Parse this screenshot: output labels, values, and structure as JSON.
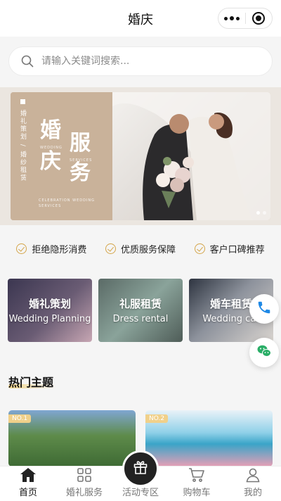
{
  "navbar": {
    "title": "婚庆"
  },
  "search": {
    "placeholder": "请输入关键词搜索..."
  },
  "banner": {
    "strip_text": "婚礼策划 / 婚纱租赁",
    "big": [
      "婚",
      "服",
      "庆",
      "务"
    ],
    "mini_top": "WEDDING",
    "mini_right": "SERVICES",
    "mini_bottom": "CELEBRATION WEDDING SERVICES"
  },
  "guarantees": [
    "拒绝隐形消费",
    "优质服务保障",
    "客户口碑推荐"
  ],
  "services": [
    {
      "zh": "婚礼策划",
      "en": "Wedding Planning"
    },
    {
      "zh": "礼服租赁",
      "en": "Dress rental"
    },
    {
      "zh": "婚车租赁",
      "en": "Wedding car"
    }
  ],
  "hot": {
    "title": "热门主题",
    "topics": [
      {
        "badge": "NO.1"
      },
      {
        "badge": "NO.2"
      }
    ]
  },
  "tabbar": {
    "items": [
      {
        "label": "首页",
        "icon": "home-icon"
      },
      {
        "label": "婚礼服务",
        "icon": "grid-icon"
      },
      {
        "label": "活动专区",
        "icon": "gift-icon"
      },
      {
        "label": "购物车",
        "icon": "cart-icon"
      },
      {
        "label": "我的",
        "icon": "user-icon"
      }
    ]
  },
  "colors": {
    "accent_gold": "#d4a54a",
    "banner_tan": "#c9b29a",
    "phone_blue": "#1e88e5",
    "wechat_green": "#2aae67"
  }
}
